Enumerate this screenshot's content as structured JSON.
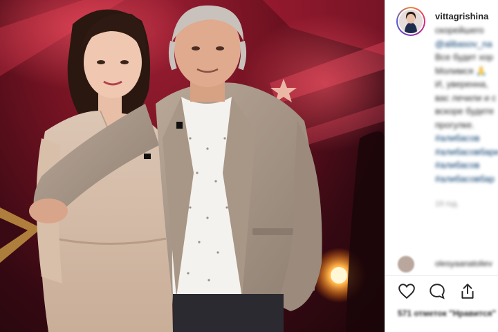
{
  "post": {
    "author": {
      "username": "vittagrishina",
      "avatar_icon": "profile-avatar"
    },
    "caption_lines": [
      "скорейшего",
      "@alibasov_na",
      "Все будет хор",
      "Молимся 🙏",
      "И, уверенна,",
      "вас лечили и с",
      "вскоре будете",
      "прогулке."
    ],
    "hashtags": [
      "#алибасов",
      "#алибасовбари",
      "#алибасов",
      "#алибасовбар"
    ],
    "posted_ago": "19 год.",
    "comments": [
      {
        "username": "olesyaanatoliev",
        "text": ""
      }
    ],
    "likes_text": "571 отметок \"Нравится\""
  },
  "actions": {
    "like_icon": "heart-icon",
    "comment_icon": "comment-icon",
    "share_icon": "share-icon"
  },
  "colors": {
    "link": "#003569",
    "text": "#262626",
    "muted": "#999999",
    "stage_red": "#8a1628"
  }
}
